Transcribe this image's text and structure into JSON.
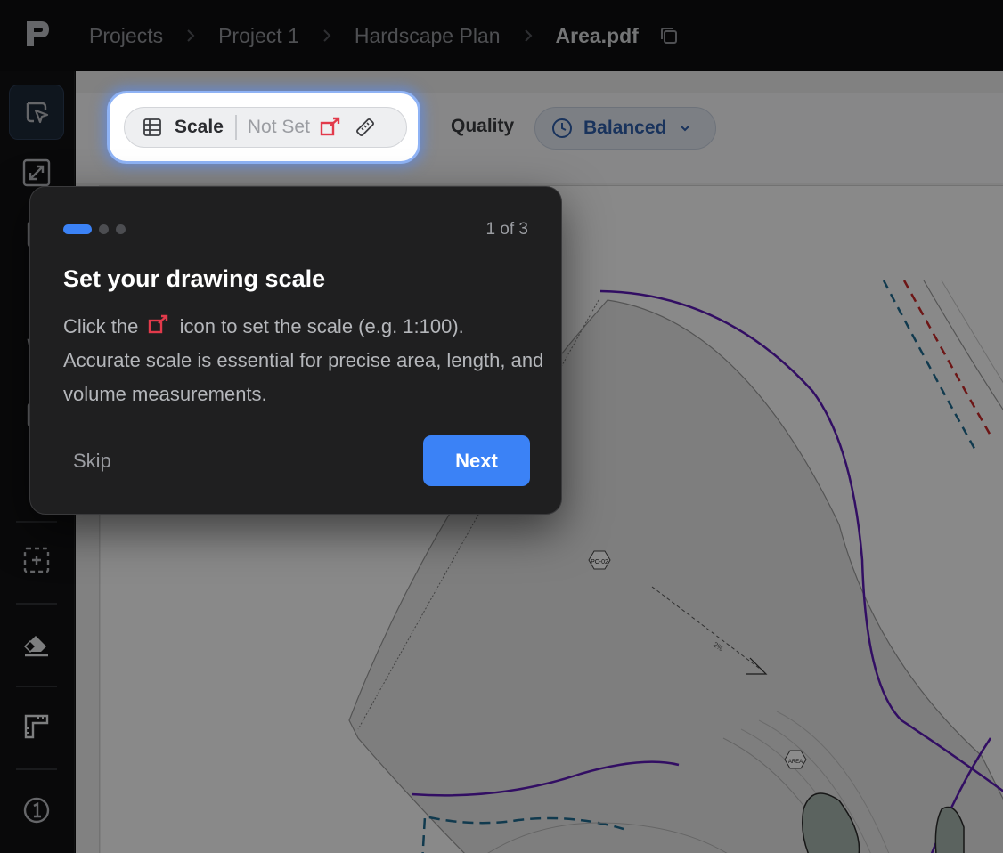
{
  "breadcrumb": {
    "items": [
      {
        "label": "Projects"
      },
      {
        "label": "Project 1"
      },
      {
        "label": "Hardscape Plan"
      },
      {
        "label": "Area.pdf"
      }
    ]
  },
  "toolbar": {
    "scale_label": "Scale",
    "scale_value": "Not Set",
    "quality_label": "Quality",
    "quality_value": "Balanced"
  },
  "tour": {
    "step_text": "1 of 3",
    "steps_total": 3,
    "current_step": 1,
    "title": "Set your drawing scale",
    "body_before_icon": "Click the",
    "body_after_icon": "icon to set the scale (e.g. 1:100). Accurate scale is essential for precise area, length, and volume measurements.",
    "skip_label": "Skip",
    "next_label": "Next"
  },
  "sidebar": {
    "tools": [
      {
        "icon": "select-pointer-icon",
        "active": true
      },
      {
        "icon": "resize-diagonal-icon"
      },
      {
        "icon": "tool-3-icon"
      },
      {
        "icon": "tool-4-icon"
      },
      {
        "icon": "tool-5-icon"
      },
      {
        "icon": "tool-6-icon"
      },
      {
        "icon": "tool-7-icon"
      },
      {
        "icon": "area-dotted-icon"
      },
      {
        "icon": "eraser-icon"
      },
      {
        "icon": "ruler-corner-icon"
      },
      {
        "icon": "info-one-icon"
      }
    ]
  },
  "plan_annotations": [
    "PC-02",
    "2%",
    "AREA"
  ],
  "colors": {
    "accent": "#3b82f6",
    "scale_warning": "#e23a4b",
    "boundary": "#5b1bb5"
  }
}
